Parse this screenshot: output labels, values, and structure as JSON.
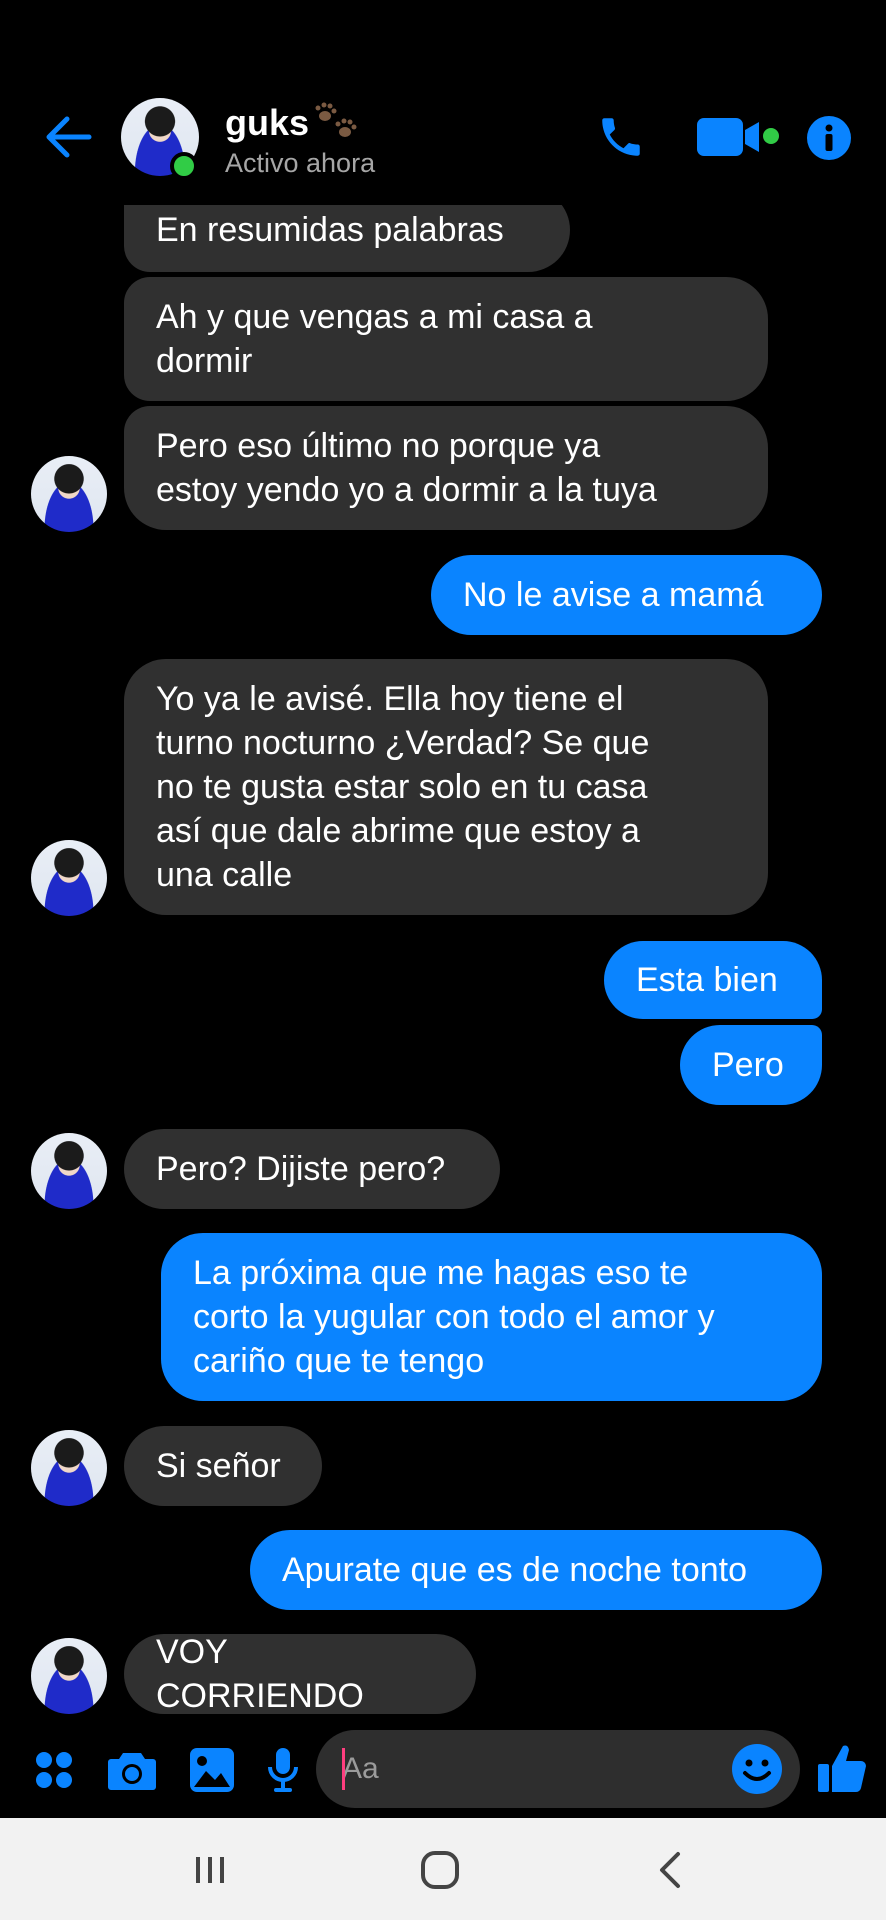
{
  "header": {
    "name": "guks",
    "status": "Activo ahora"
  },
  "messages": [
    {
      "side": "in",
      "text": "En resumidas palabras"
    },
    {
      "side": "in",
      "text": "Ah y que vengas a mi casa a\ndormir"
    },
    {
      "side": "in",
      "text": "Pero eso último no porque ya\nestoy yendo yo a dormir a la tuya"
    },
    {
      "side": "out",
      "text": "No le avise a mamá"
    },
    {
      "side": "in",
      "text": "Yo ya le avisé. Ella hoy tiene el\nturno nocturno ¿Verdad? Se que\nno te gusta estar solo en tu casa\nasí que dale abrime que estoy a\nuna calle"
    },
    {
      "side": "out",
      "text": "Esta bien"
    },
    {
      "side": "out",
      "text": "Pero"
    },
    {
      "side": "in",
      "text": "Pero? Dijiste pero?"
    },
    {
      "side": "out",
      "text": "La próxima que me hagas eso te\ncorto la yugular con todo el amor y\ncariño que te tengo"
    },
    {
      "side": "in",
      "text": "Si señor"
    },
    {
      "side": "out",
      "text": "Apurate que es de noche tonto"
    },
    {
      "side": "in",
      "text": "VOY CORRIENDO"
    }
  ],
  "composer": {
    "placeholder": "Aa"
  },
  "icons": {
    "back": "back-arrow-icon",
    "call": "phone-icon",
    "video": "video-camera-icon",
    "info": "info-icon",
    "menu": "grid-dots-icon",
    "camera": "camera-icon",
    "gallery": "image-icon",
    "mic": "microphone-icon",
    "emoji": "emoji-icon",
    "like": "thumbs-up-icon",
    "paws": "paw-prints-icon"
  },
  "colors": {
    "accent": "#0a84ff",
    "incoming_bubble": "#303030",
    "online": "#31cc46"
  }
}
